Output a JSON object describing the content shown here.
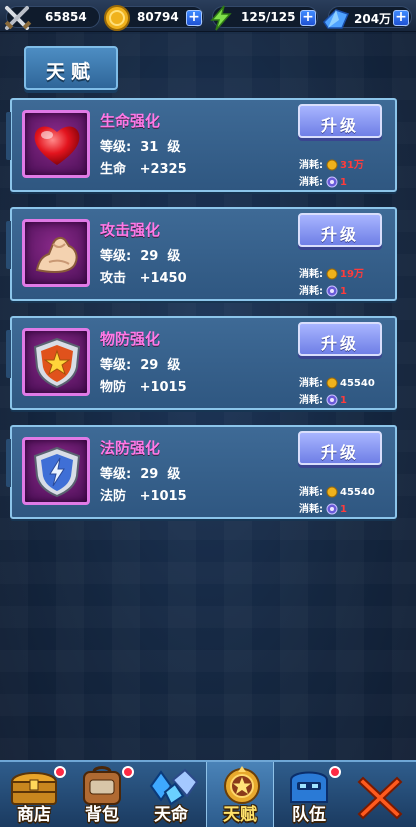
{
  "topbar": {
    "power": "65854",
    "gold": "80794",
    "energy": "125/125",
    "gems": "204万",
    "icons": [
      "crossed-swords-icon",
      "gold-coin-icon",
      "lightning-icon",
      "blue-crystal-icon"
    ]
  },
  "tab": {
    "title": "天赋"
  },
  "cards": [
    {
      "name": "生命强化",
      "level": "等级:  31  级",
      "stat": "生命   +2325",
      "icon": "heart-icon",
      "button": "升级",
      "cost_label": "消耗:",
      "gold_cost": "31万",
      "gold_cost_color": "#ff3b3b",
      "item_cost": "1"
    },
    {
      "name": "攻击强化",
      "level": "等级:  29  级",
      "stat": "攻击   +1450",
      "icon": "muscle-arm-icon",
      "button": "升级",
      "cost_label": "消耗:",
      "gold_cost": "19万",
      "gold_cost_color": "#ff3b3b",
      "item_cost": "1"
    },
    {
      "name": "物防强化",
      "level": "等级:  29  级",
      "stat": "物防   +1015",
      "icon": "star-shield-icon",
      "button": "升级",
      "cost_label": "消耗:",
      "gold_cost": "45540",
      "gold_cost_color": "#ffffff",
      "item_cost": "1"
    },
    {
      "name": "法防强化",
      "level": "等级:  29  级",
      "stat": "法防   +1015",
      "icon": "lightning-shield-icon",
      "button": "升级",
      "cost_label": "消耗:",
      "gold_cost": "45540",
      "gold_cost_color": "#ffffff",
      "item_cost": "1"
    }
  ],
  "nav": {
    "items": [
      {
        "label": "商店",
        "icon": "treasure-chest-icon",
        "badge": true
      },
      {
        "label": "背包",
        "icon": "backpack-icon",
        "badge": true
      },
      {
        "label": "天命",
        "icon": "fate-crystal-icon",
        "badge": false
      },
      {
        "label": "天赋",
        "icon": "talent-emblem-icon",
        "badge": false,
        "active": true
      },
      {
        "label": "队伍",
        "icon": "team-helmet-icon",
        "badge": true
      }
    ],
    "close_icon": "close-x-icon"
  },
  "colors": {
    "accent_pink": "#ff79e6",
    "cost_red": "#ff3b3b",
    "button_purple": "#8593f3"
  }
}
